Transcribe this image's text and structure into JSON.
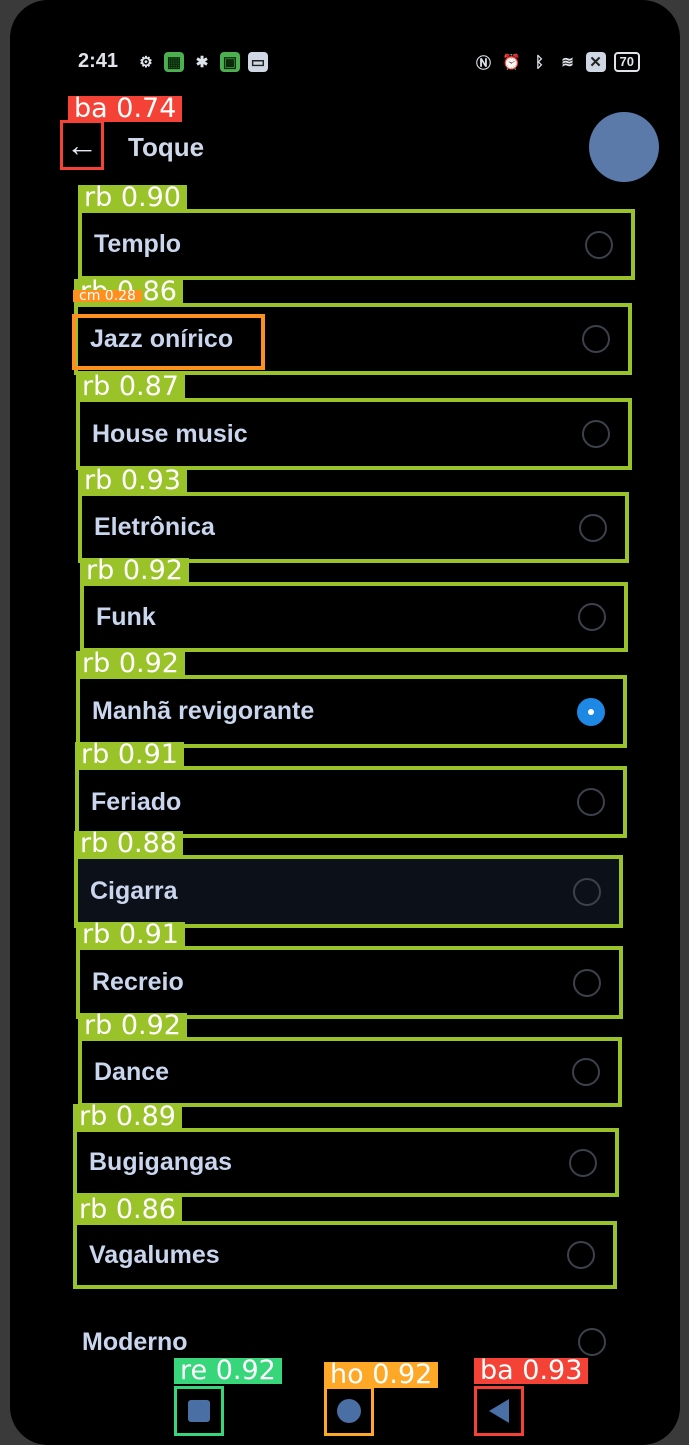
{
  "status_bar": {
    "time": "2:41",
    "battery": "70",
    "left_icons": [
      "settings-icon",
      "grid-app-icon",
      "bug-icon",
      "green-app-icon",
      "message-icon"
    ],
    "right_icons": [
      "nfc-icon",
      "alarm-icon",
      "bluetooth-icon",
      "wifi-icon",
      "close-box-icon"
    ]
  },
  "header": {
    "title": "Toque"
  },
  "ringtones": [
    {
      "label": "Templo",
      "selected": false,
      "tag": "rb 0.90"
    },
    {
      "label": "Jazz onírico",
      "selected": false,
      "tag": "rb 0.86"
    },
    {
      "label": "House music",
      "selected": false,
      "tag": "rb 0.87"
    },
    {
      "label": "Eletrônica",
      "selected": false,
      "tag": "rb 0.93"
    },
    {
      "label": "Funk",
      "selected": false,
      "tag": "rb 0.92"
    },
    {
      "label": "Manhã revigorante",
      "selected": true,
      "tag": "rb 0.92"
    },
    {
      "label": "Feriado",
      "selected": false,
      "tag": "rb 0.91"
    },
    {
      "label": "Cigarra",
      "selected": false,
      "tag": "rb 0.88"
    },
    {
      "label": "Recreio",
      "selected": false,
      "tag": "rb 0.91"
    },
    {
      "label": "Dance",
      "selected": false,
      "tag": "rb 0.92"
    },
    {
      "label": "Bugigangas",
      "selected": false,
      "tag": "rb 0.89"
    },
    {
      "label": "Vagalumes",
      "selected": false,
      "tag": "rb 0.86"
    }
  ],
  "last_item": {
    "label": "Moderno",
    "selected": false
  },
  "annotations": {
    "back": "ba 0.74",
    "jazz_box": "cm 0.28",
    "recents": "re 0.92",
    "home": "ho 0.92",
    "nav_back": "ba 0.93"
  },
  "colors": {
    "row_box": "#9ac32a",
    "back_box": "#f44336",
    "jazz_box": "#ff8f1f",
    "recents_box": "#37d67a",
    "home_box": "#ffa726",
    "radio_selected": "#1e88e5",
    "avatar": "#5b79a9"
  }
}
